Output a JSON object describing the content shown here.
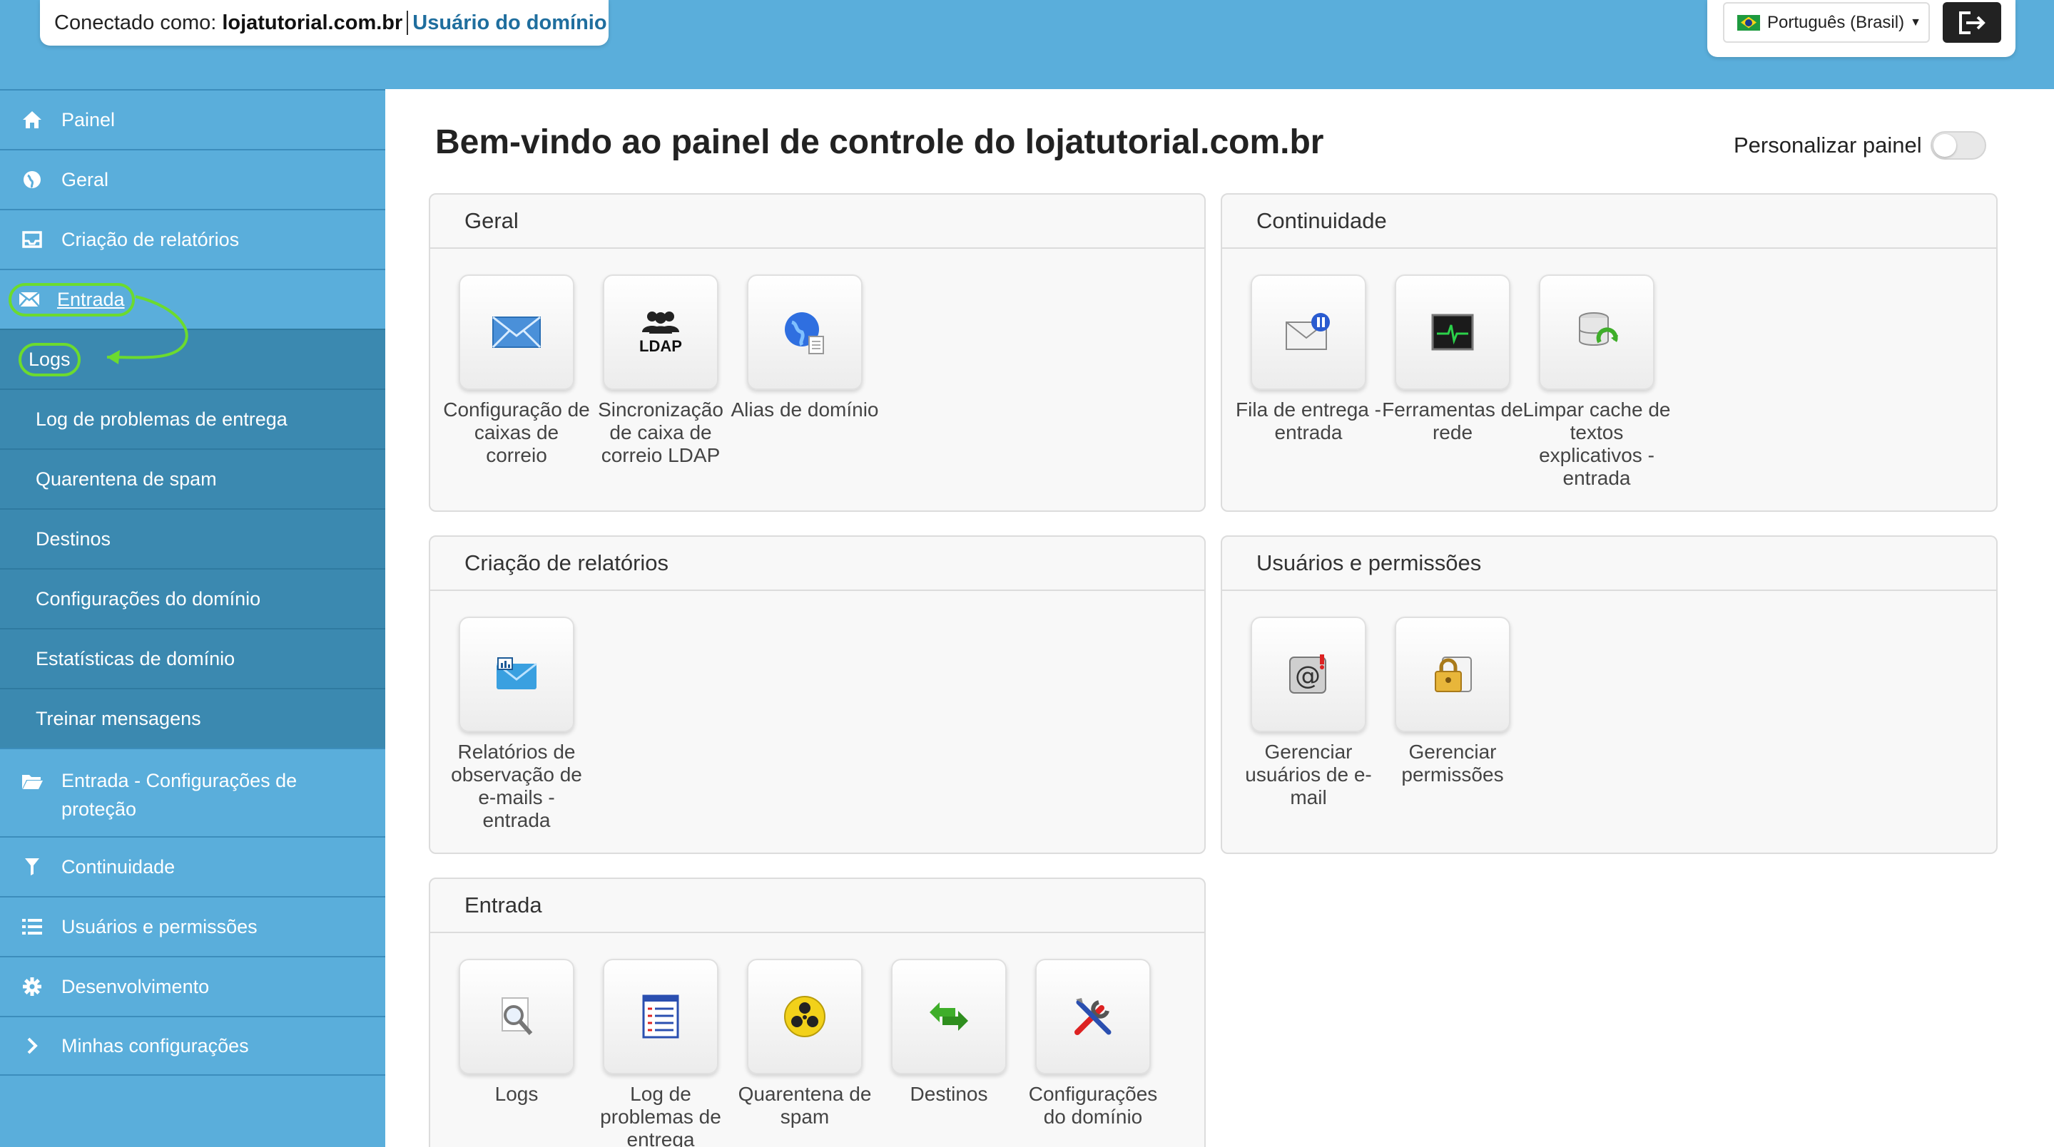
{
  "header": {
    "login_label": "Conectado como:",
    "login_domain": "lojatutorial.com.br",
    "login_role": "Usuário do domínio",
    "language": "Português (Brasil)",
    "logout_icon": "logout-icon"
  },
  "sidebar": {
    "items": [
      {
        "label": "Painel",
        "icon": "home-icon"
      },
      {
        "label": "Geral",
        "icon": "globe-icon"
      },
      {
        "label": "Criação de relatórios",
        "icon": "inbox-icon"
      },
      {
        "label": "Entrada",
        "icon": "envelope-icon"
      },
      {
        "label": "Entrada - Configurações de proteção",
        "icon": "folder-open-icon"
      },
      {
        "label": "Continuidade",
        "icon": "filter-icon"
      },
      {
        "label": "Usuários e permissões",
        "icon": "list-icon"
      },
      {
        "label": "Desenvolvimento",
        "icon": "gear-icon"
      },
      {
        "label": "Minhas configurações",
        "icon": "chevron-right-icon"
      }
    ],
    "sub_items": [
      "Logs",
      "Log de problemas de entrega",
      "Quarentena de spam",
      "Destinos",
      "Configurações do domínio",
      "Estatísticas de domínio",
      "Treinar mensagens"
    ]
  },
  "main": {
    "title": "Bem-vindo ao painel de controle do lojatutorial.com.br",
    "customize_label": "Personalizar painel",
    "customize_enabled": false,
    "panels": {
      "geral": {
        "title": "Geral",
        "tiles": [
          "Configuração de caixas de correio",
          "Sincronização de caixa de correio LDAP",
          "Alias de domínio"
        ]
      },
      "continuidade": {
        "title": "Continuidade",
        "tiles": [
          "Fila de entrega - entrada",
          "Ferramentas de rede",
          "Limpar cache de textos explicativos - entrada"
        ]
      },
      "relatorios": {
        "title": "Criação de relatórios",
        "tiles": [
          "Relatórios de observação de e-mails - entrada"
        ]
      },
      "usuarios": {
        "title": "Usuários e permissões",
        "tiles": [
          "Gerenciar usuários de e-mail",
          "Gerenciar permissões"
        ]
      },
      "entrada": {
        "title": "Entrada",
        "tiles": [
          "Logs",
          "Log de problemas de entrega",
          "Quarentena de spam",
          "Destinos",
          "Configurações do domínio"
        ]
      }
    },
    "ldap_badge": "LDAP"
  },
  "colors": {
    "sidebar": "#5aaedb",
    "submenu": "#3b89b0",
    "highlight": "#6cdb2e",
    "role_link": "#1f6e9e"
  }
}
